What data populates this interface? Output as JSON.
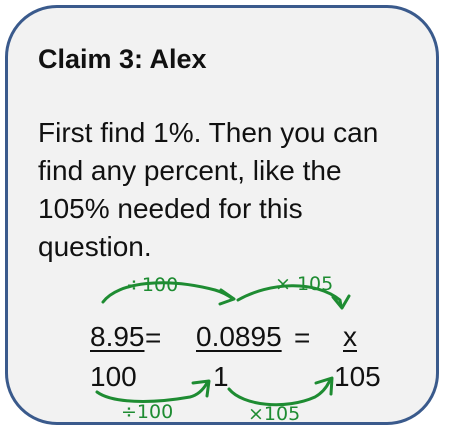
{
  "card": {
    "title": "Claim 3: Alex",
    "lines": [
      "First find 1%. Then you can",
      "find any percent, like the",
      "105% needed for this",
      "question."
    ]
  },
  "equation": {
    "frac1_numerator": "8.95",
    "frac1_denominator": "100",
    "eq_sign_1": "=",
    "frac2_numerator": "0.0895",
    "frac2_denominator": "1",
    "eq_sign_2": "=",
    "frac3_numerator": "x",
    "frac3_denominator": "105"
  },
  "annotations": {
    "top_left": "÷100",
    "top_right": "× 105",
    "bottom_left": "÷100",
    "bottom_right": "×105",
    "color": "#1e8c32"
  }
}
